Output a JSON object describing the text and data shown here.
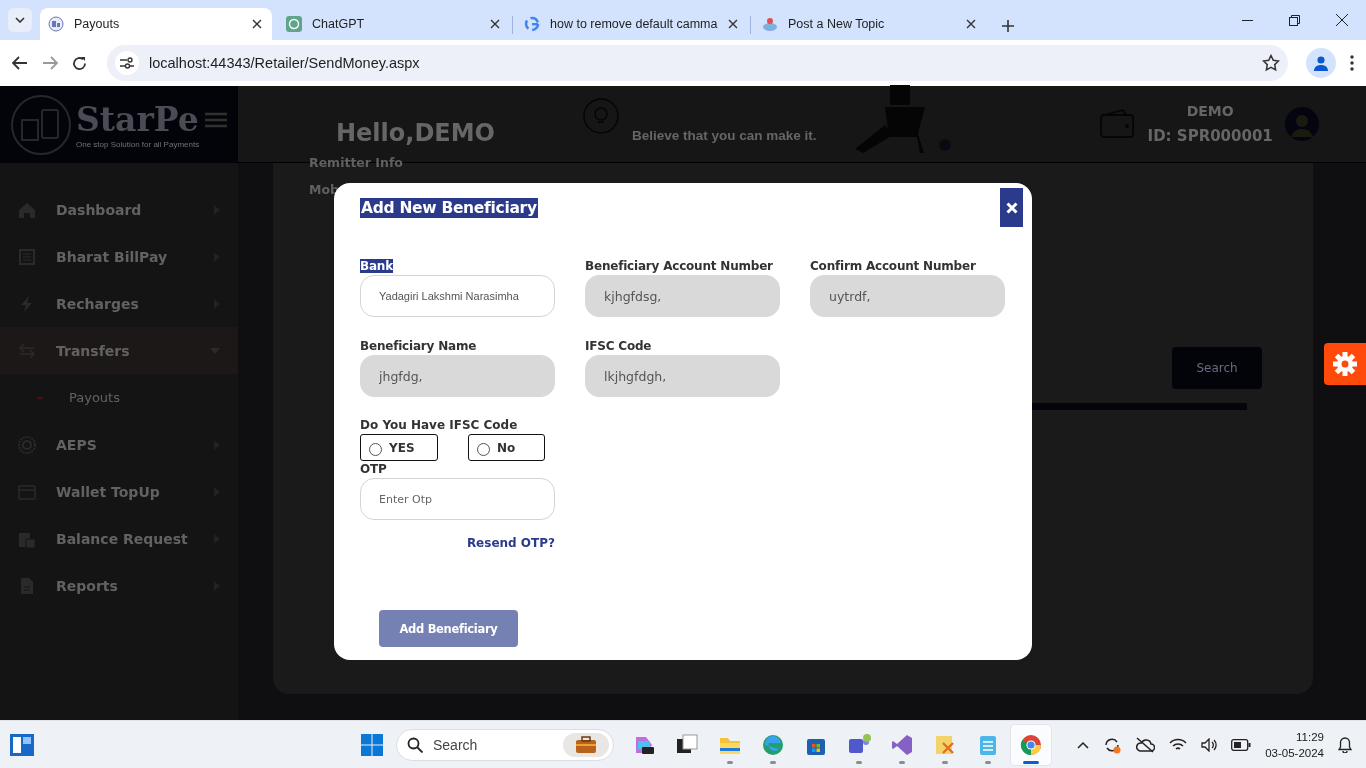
{
  "browser": {
    "tabs": [
      {
        "title": "Payouts",
        "selected": true
      },
      {
        "title": "ChatGPT",
        "selected": false
      },
      {
        "title": "how to remove default camma",
        "selected": false
      },
      {
        "title": "Post a New Topic",
        "selected": false
      }
    ],
    "address": "localhost:44343/Retailer/SendMoney.aspx"
  },
  "logo": {
    "name": "StarPe",
    "tagline": "One stop Solution for all Payments"
  },
  "sidebar": {
    "items": [
      {
        "label": "Dashboard",
        "expanded": false
      },
      {
        "label": "Bharat BillPay",
        "expanded": false
      },
      {
        "label": "Recharges",
        "expanded": false
      },
      {
        "label": "Transfers",
        "expanded": true,
        "children": [
          {
            "label": "Payouts"
          }
        ]
      },
      {
        "label": "AEPS",
        "expanded": false
      },
      {
        "label": "Wallet TopUp",
        "expanded": false
      },
      {
        "label": "Balance Request",
        "expanded": false
      },
      {
        "label": "Reports",
        "expanded": false
      }
    ]
  },
  "header": {
    "greeting": "Hello,DEMO",
    "tip": "Believe that you can make it.",
    "user_name": "DEMO",
    "user_id": "ID: SPR000001"
  },
  "background_form": {
    "section_title": "Remitter Info",
    "field_label": "Mob",
    "search_button": "Search"
  },
  "modal": {
    "title": "Add New Beneficiary",
    "title_highlighted": true,
    "fields": [
      {
        "label": "Bank",
        "value": "Yadagiri Lakshmi Narasimha",
        "disabled": false,
        "label_highlighted": true
      },
      {
        "label": "Beneficiary Account Number",
        "value": "kjhgfdsg,",
        "disabled": true,
        "label_highlighted": false
      },
      {
        "label": "Confirm Account Number",
        "value": "uytrdf,",
        "disabled": true,
        "label_highlighted": false
      },
      {
        "label": "Beneficiary Name",
        "value": "jhgfdg,",
        "disabled": true,
        "label_highlighted": false
      },
      {
        "label": "IFSC Code",
        "value": "lkjhgfdgh,",
        "disabled": true,
        "label_highlighted": false
      }
    ],
    "ifsc_question": "Do You Have IFSC Code",
    "ifsc_options": [
      {
        "label": "YES",
        "selected": false
      },
      {
        "label": "No",
        "selected": false
      }
    ],
    "otp": {
      "label": "OTP",
      "placeholder": "Enter Otp"
    },
    "resend_link": "Resend OTP?",
    "submit_button": "Add Beneficiary"
  },
  "taskbar": {
    "search_placeholder": "Search",
    "time": "11:29",
    "date": "03-05-2024",
    "apps": [
      {
        "running": false,
        "selected": false
      },
      {
        "running": false,
        "selected": false
      },
      {
        "running": true,
        "selected": false
      },
      {
        "running": true,
        "selected": false
      },
      {
        "running": false,
        "selected": false
      },
      {
        "running": true,
        "selected": false
      },
      {
        "running": true,
        "selected": false
      },
      {
        "running": true,
        "selected": false
      },
      {
        "running": true,
        "selected": false
      },
      {
        "running": true,
        "selected": true
      }
    ]
  }
}
